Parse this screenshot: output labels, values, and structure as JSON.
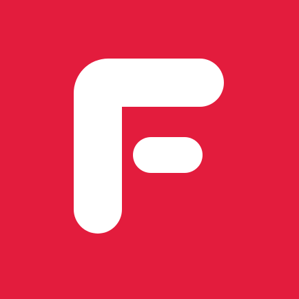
{
  "icon": {
    "logo_name": "F-logo-icon",
    "background_color": "#E31C3D",
    "glyph_color": "#FFFFFF"
  }
}
